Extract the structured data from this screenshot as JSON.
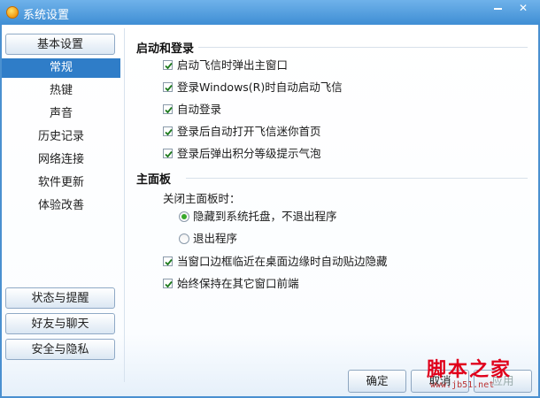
{
  "window": {
    "title": "系统设置",
    "minimize_label": "—",
    "close_label": "✕"
  },
  "sidebar": {
    "top_group": "基本设置",
    "items": [
      "常规",
      "热键",
      "声音",
      "历史记录",
      "网络连接",
      "软件更新",
      "体验改善"
    ],
    "active_index": 0,
    "bottom_groups": [
      "状态与提醒",
      "好友与聊天",
      "安全与隐私"
    ]
  },
  "sections": {
    "startup": {
      "title": "启动和登录",
      "options": [
        {
          "label": "启动飞信时弹出主窗口",
          "checked": true
        },
        {
          "label": "登录Windows(R)时自动启动飞信",
          "checked": true
        },
        {
          "label": "自动登录",
          "checked": true
        },
        {
          "label": "登录后自动打开飞信迷你首页",
          "checked": true
        },
        {
          "label": "登录后弹出积分等级提示气泡",
          "checked": true
        }
      ]
    },
    "main_panel": {
      "title": "主面板",
      "close_prompt": "关闭主面板时：",
      "radios": [
        {
          "label": "隐藏到系统托盘，不退出程序",
          "selected": true
        },
        {
          "label": "退出程序",
          "selected": false
        }
      ],
      "options": [
        {
          "label": "当窗口边框临近在桌面边缘时自动贴边隐藏",
          "checked": true
        },
        {
          "label": "始终保持在其它窗口前端",
          "checked": true
        }
      ]
    }
  },
  "buttons": {
    "ok": "确定",
    "cancel": "取消",
    "apply": "应用"
  },
  "watermark": {
    "main": "脚本之家",
    "sub": "www.jb51.net"
  },
  "colors": {
    "title_bar": "#3f8ed4",
    "active_nav": "#2f7dc8",
    "radio_dot": "#38a82b",
    "watermark": "#e0001b"
  }
}
